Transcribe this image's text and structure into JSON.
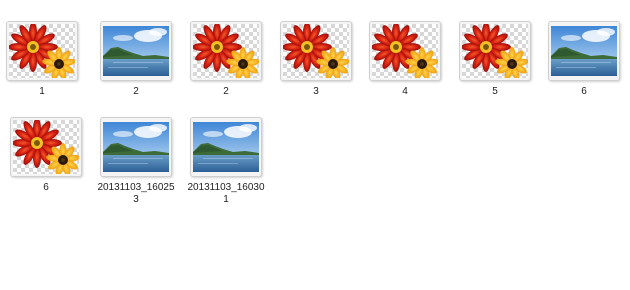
{
  "files": [
    {
      "name": "1",
      "icon": "flower-image-icon"
    },
    {
      "name": "2",
      "icon": "landscape-image-icon"
    },
    {
      "name": "2",
      "icon": "flower-image-icon"
    },
    {
      "name": "3",
      "icon": "flower-image-icon"
    },
    {
      "name": "4",
      "icon": "flower-image-icon"
    },
    {
      "name": "5",
      "icon": "flower-image-icon"
    },
    {
      "name": "6",
      "icon": "landscape-image-icon"
    },
    {
      "name": "6",
      "icon": "flower-image-icon"
    },
    {
      "name": "20131103_160253",
      "icon": "landscape-image-icon"
    },
    {
      "name": "20131103_160301",
      "icon": "landscape-image-icon"
    }
  ]
}
